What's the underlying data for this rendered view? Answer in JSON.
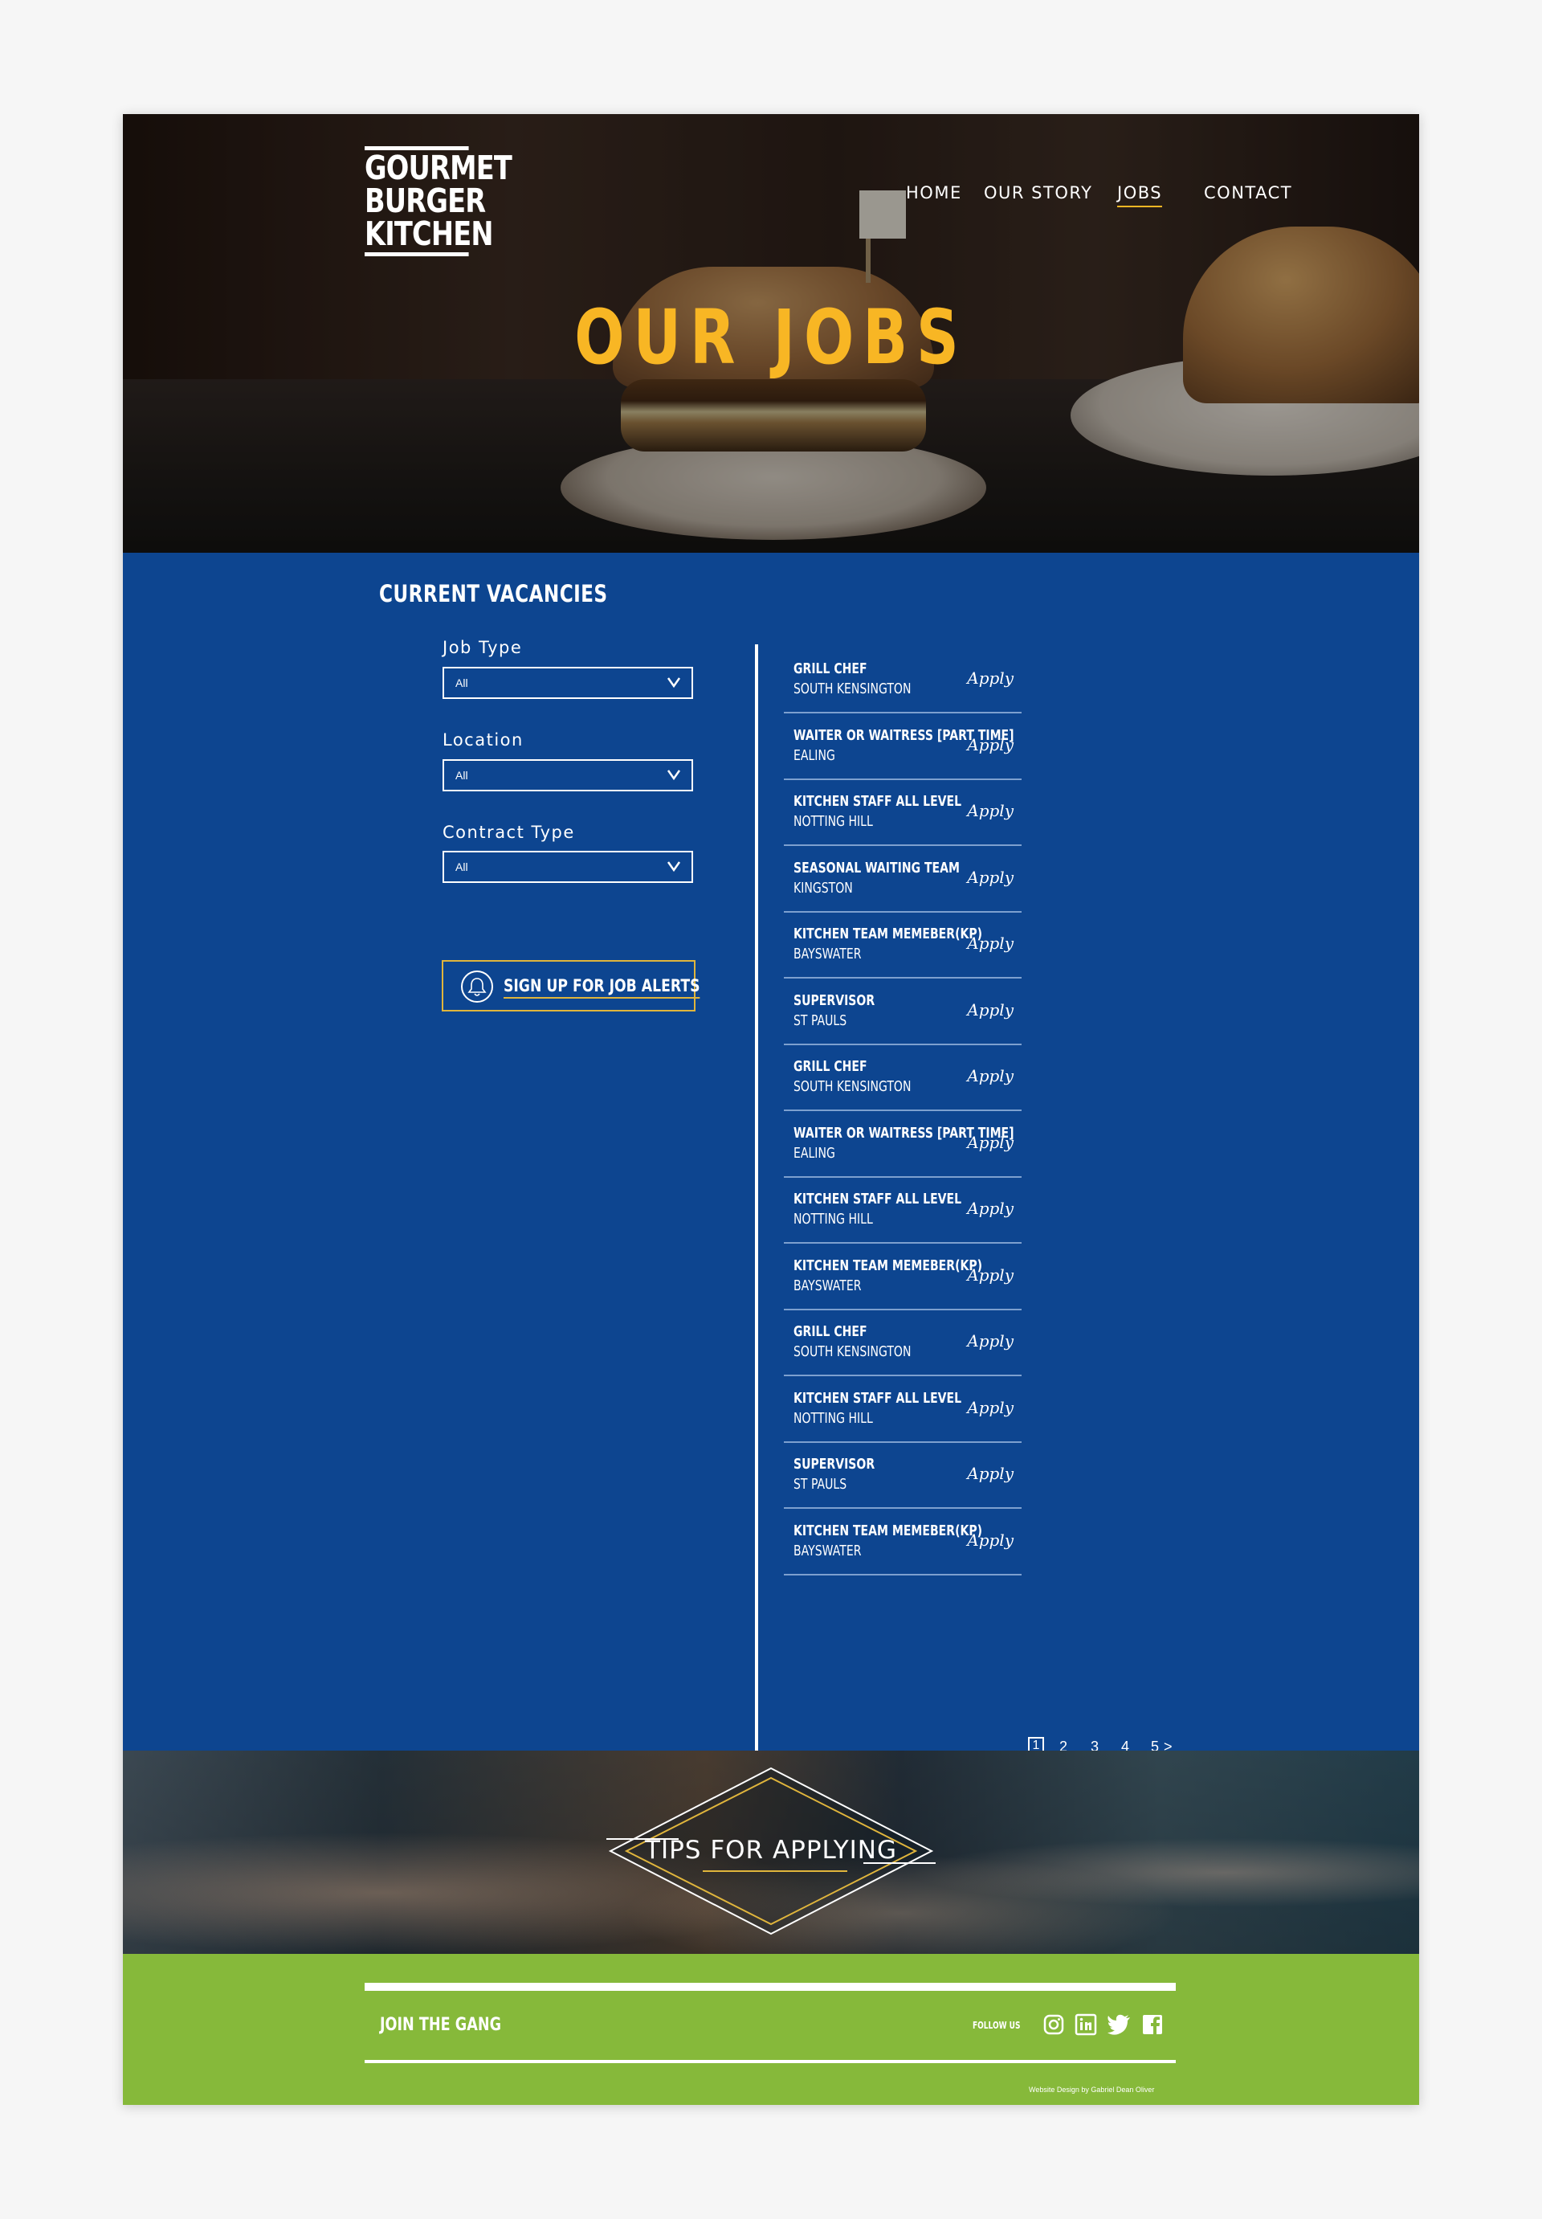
{
  "brand": {
    "logo_lines": [
      "GOURMET",
      "BURGER",
      "KITCHEN"
    ]
  },
  "nav": {
    "items": [
      {
        "label": "HOME",
        "active": false
      },
      {
        "label": "OUR STORY",
        "active": false
      },
      {
        "label": "JOBS",
        "active": true
      },
      {
        "label": "CONTACT",
        "active": false
      }
    ]
  },
  "hero": {
    "title": "OUR JOBS"
  },
  "vacancies": {
    "title": "CURRENT VACANCIES",
    "filters": [
      {
        "label": "Job Type",
        "value": "All"
      },
      {
        "label": "Location",
        "value": "All"
      },
      {
        "label": "Contract Type",
        "value": "All"
      }
    ],
    "alert_button": "SIGN UP FOR JOB ALERTS",
    "apply_label": "Apply",
    "jobs": [
      {
        "title": "GRILL CHEF",
        "location": "SOUTH KENSINGTON"
      },
      {
        "title": "WAITER OR WAITRESS [PART TIME]",
        "location": "EALING"
      },
      {
        "title": "KITCHEN STAFF ALL LEVEL",
        "location": "NOTTING HILL"
      },
      {
        "title": "SEASONAL WAITING TEAM",
        "location": "KINGSTON"
      },
      {
        "title": "KITCHEN TEAM MEMEBER(KP)",
        "location": "BAYSWATER"
      },
      {
        "title": "SUPERVISOR",
        "location": "ST PAULS"
      },
      {
        "title": "GRILL CHEF",
        "location": "SOUTH KENSINGTON"
      },
      {
        "title": "WAITER OR WAITRESS [PART TIME]",
        "location": "EALING"
      },
      {
        "title": "KITCHEN STAFF ALL LEVEL",
        "location": "NOTTING HILL"
      },
      {
        "title": "KITCHEN TEAM MEMEBER(KP)",
        "location": "BAYSWATER"
      },
      {
        "title": "GRILL CHEF",
        "location": "SOUTH KENSINGTON"
      },
      {
        "title": "KITCHEN STAFF ALL LEVEL",
        "location": "NOTTING HILL"
      },
      {
        "title": "SUPERVISOR",
        "location": "ST PAULS"
      },
      {
        "title": "KITCHEN TEAM MEMEBER(KP)",
        "location": "BAYSWATER"
      }
    ],
    "pagination": {
      "pages": [
        "1",
        "2",
        "3",
        "4",
        "5"
      ],
      "current": "1",
      "next": ">"
    }
  },
  "tips": {
    "label": "TIPS FOR APPLYING"
  },
  "footer": {
    "join": "JOIN THE GANG",
    "follow": "FOLLOW US",
    "social": [
      "instagram-icon",
      "linkedin-icon",
      "twitter-icon",
      "facebook-icon"
    ],
    "credit": "Website Design by Gabriel Dean Oliver"
  },
  "colors": {
    "brand_blue": "#0d4590",
    "accent_yellow": "#f8b624",
    "footer_green": "#86b93a"
  }
}
